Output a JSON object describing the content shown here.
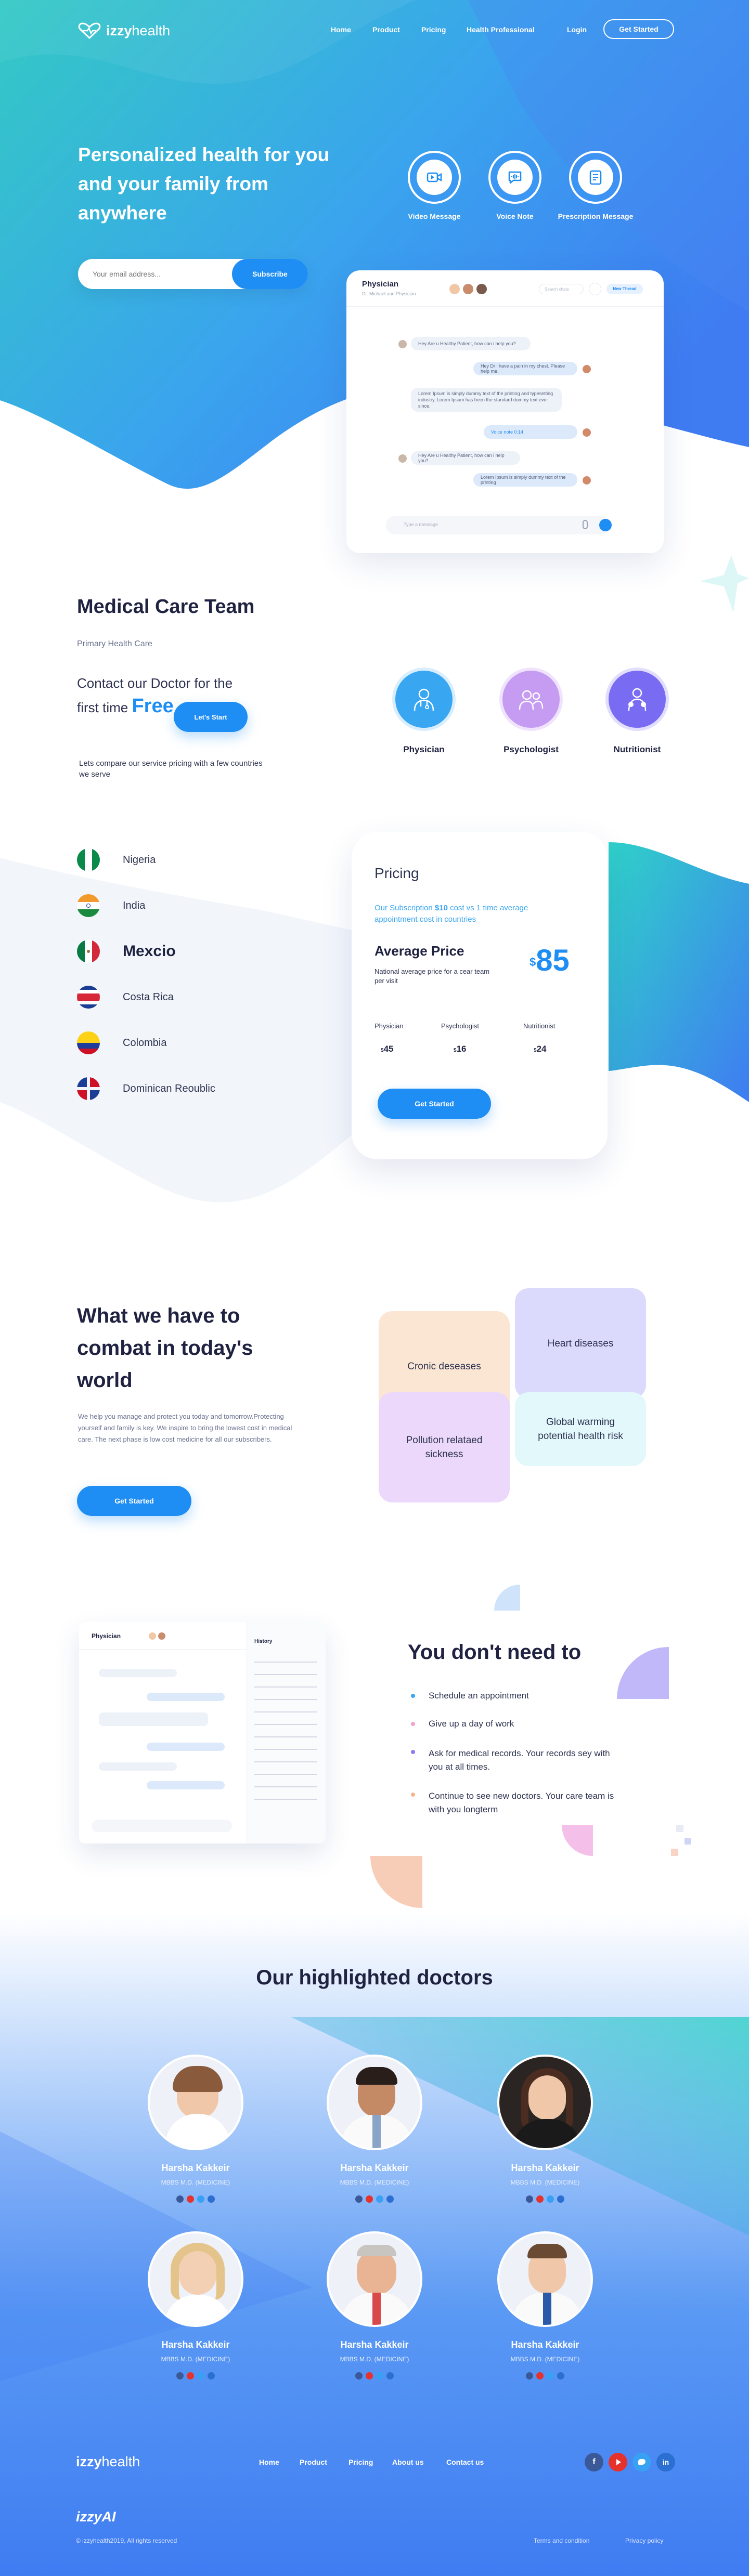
{
  "brand": {
    "name_bold": "izzy",
    "name_light": "health"
  },
  "nav": {
    "items": [
      "Home",
      "Product",
      "Pricing",
      "Health Professional"
    ],
    "login": "Login",
    "cta": "Get Started"
  },
  "hero": {
    "title": "Personalized health for you and your family from anywhere",
    "email_placeholder": "Your email address...",
    "subscribe": "Subscribe",
    "features": [
      {
        "label": "Video Message",
        "icon": "video-icon"
      },
      {
        "label": "Voice Note",
        "icon": "voice-icon"
      },
      {
        "label": "Prescription Message",
        "icon": "prescription-icon"
      }
    ]
  },
  "chat_preview": {
    "title": "Physician",
    "subtitle": "Dr. Michael and Physician",
    "search_placeholder": "Search chats",
    "new_thread": "New Thread",
    "input_placeholder": "Type a message",
    "messages": [
      {
        "side": "l",
        "text": "Hey Are u Healthy Patient, how can i help you?"
      },
      {
        "side": "r",
        "text": "Hey Dr i have a pain in my chest. Please help me."
      },
      {
        "side": "l",
        "text": "Lorem Ipsum is simply dummy text of the printing and typesetting industry. Lorem Ipsum has been the standard dummy text ever since."
      },
      {
        "side": "r",
        "text": "Voice note 0:14"
      },
      {
        "side": "l",
        "text": "Hey Are u Healthy Patient, how can i help you?"
      },
      {
        "side": "r",
        "text": "Lorem Ipsum is simply dummy text of the printing"
      }
    ]
  },
  "team": {
    "title": "Medical Care Team",
    "subtitle": "Primary Health Care",
    "contact_text": "Contact our Doctor for the first time",
    "free": "Free",
    "start": "Let's Start",
    "compare": "Lets compare our service pricing with a few countries we serve",
    "roles": [
      {
        "label": "Physician",
        "icon": "physician-icon"
      },
      {
        "label": "Psychologist",
        "icon": "psychologist-icon"
      },
      {
        "label": "Nutritionist",
        "icon": "nutritionist-icon"
      }
    ]
  },
  "countries": [
    {
      "name": "Nigeria",
      "flag": "nigeria-flag-icon"
    },
    {
      "name": "India",
      "flag": "india-flag-icon"
    },
    {
      "name": "Mexcio",
      "flag": "mexico-flag-icon"
    },
    {
      "name": "Costa Rica",
      "flag": "costa-rica-flag-icon"
    },
    {
      "name": "Colombia",
      "flag": "colombia-flag-icon"
    },
    {
      "name": "Dominican Reoublic",
      "flag": "dominican-flag-icon"
    }
  ],
  "pricing": {
    "title": "Pricing",
    "subscription_pre": "Our Subscription ",
    "subscription_amount": "$10",
    "subscription_post": " cost vs 1 time average appointment cost in countries",
    "avg_title": "Average Price",
    "avg_desc": "National average price for a cear team per visit",
    "avg_currency": "$",
    "avg_value": "85",
    "items": [
      {
        "label": "Physician",
        "currency": "$",
        "value": "45"
      },
      {
        "label": "Psychologist",
        "currency": "$",
        "value": "16"
      },
      {
        "label": "Nutritionist",
        "currency": "$",
        "value": "24"
      }
    ],
    "cta": "Get Started"
  },
  "combat": {
    "title": "What we have to combat in today's world",
    "body": "We help you manage and protect you today and tomorrow.Protecting yourself and family is key. We inspire to bring the lowest cost in medical care. The next phase is low cost medicine for all our subscribers.",
    "cta": "Get Started",
    "tiles": [
      "Cronic deseases",
      "Heart diseases",
      "Pollution relataed sickness",
      "Global warming potential health risk"
    ]
  },
  "dont_need": {
    "title": "You don't need to",
    "items": [
      "Schedule an appointment",
      "Give up a day of work",
      "Ask for medical records. Your records sey with you at all times.",
      "Continue to see new doctors. Your care team is with you longterm"
    ],
    "history_title": "History"
  },
  "doctors": {
    "title": "Our highlighted doctors",
    "list": [
      {
        "name": "Harsha Kakkeir",
        "degree": "MBBS M.D. (MEDICINE)"
      },
      {
        "name": "Harsha Kakkeir",
        "degree": "MBBS M.D. (MEDICINE)"
      },
      {
        "name": "Harsha Kakkeir",
        "degree": "MBBS M.D. (MEDICINE)"
      },
      {
        "name": "Harsha Kakkeir",
        "degree": "MBBS M.D. (MEDICINE)"
      },
      {
        "name": "Harsha Kakkeir",
        "degree": "MBBS M.D. (MEDICINE)"
      },
      {
        "name": "Harsha Kakkeir",
        "degree": "MBBS M.D. (MEDICINE)"
      }
    ]
  },
  "footer": {
    "links": [
      "Home",
      "Product",
      "Pricing",
      "About us",
      "Contact us"
    ],
    "social": [
      "facebook-icon",
      "youtube-icon",
      "twitter-icon",
      "linkedin-icon"
    ],
    "sub_brand": "izzyAI",
    "copyright": "© izzyhealth2019, All rights reserved",
    "terms": "Terms and condition",
    "privacy": "Privacy policy"
  },
  "colors": {
    "primary": "#1e8df4",
    "teal": "#2fd1c8",
    "navy": "#1f2240"
  }
}
